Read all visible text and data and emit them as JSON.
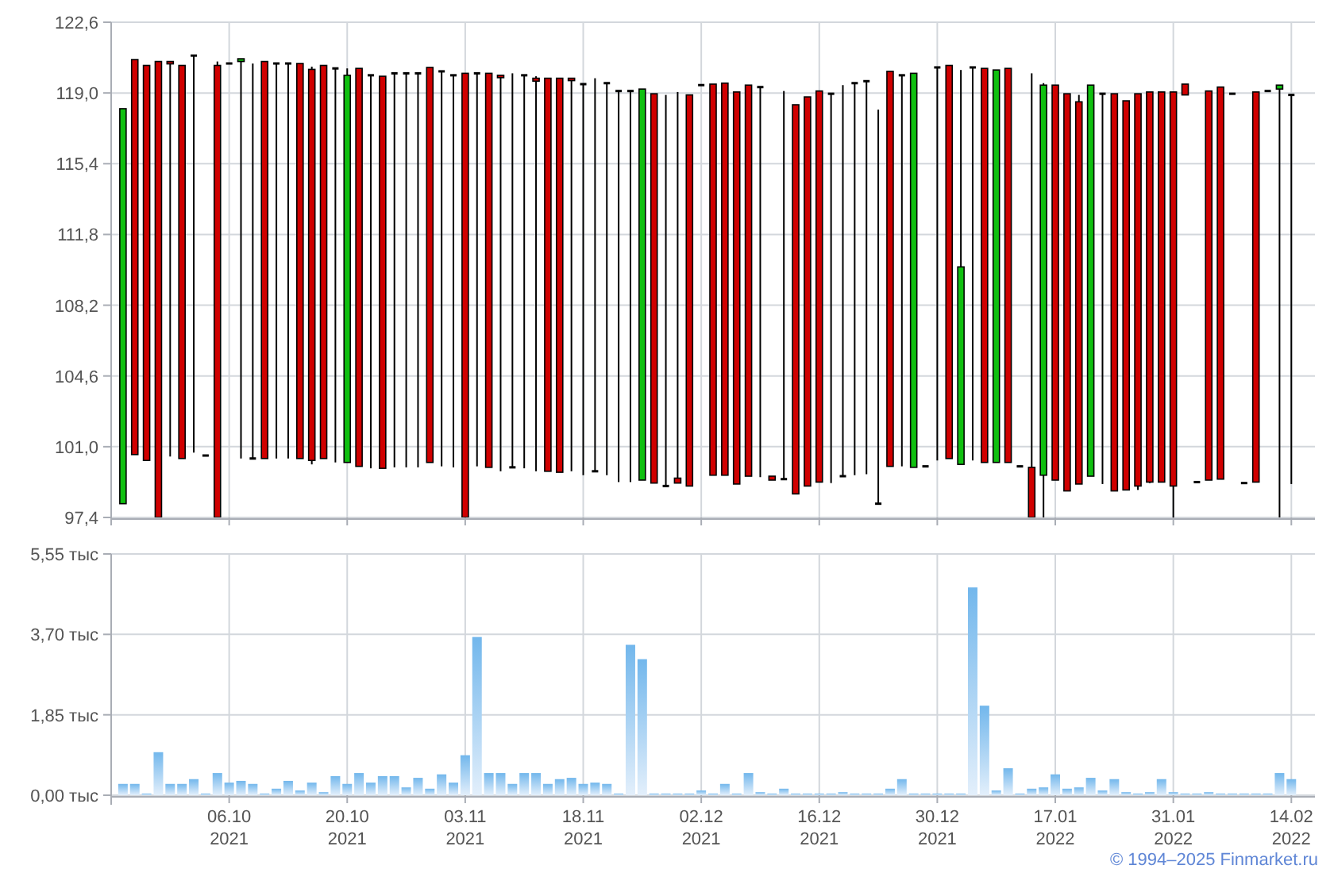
{
  "price_chart": {
    "chart_data": {
      "type": "candlestick",
      "grid": true,
      "ylim": [
        97.4,
        122.6
      ],
      "categories": [
        null,
        null,
        null,
        null,
        null,
        null,
        null,
        null,
        null,
        null,
        null,
        null,
        null,
        null,
        null,
        null,
        null,
        null,
        null,
        null,
        null,
        null,
        null,
        null,
        null,
        null,
        null,
        null,
        null,
        null,
        null,
        null,
        null,
        null,
        null,
        null,
        null,
        null,
        null,
        null,
        null,
        null,
        null,
        null,
        null,
        null,
        null,
        null,
        null,
        null,
        null,
        null,
        null,
        null,
        null,
        null,
        null,
        null,
        null,
        null,
        null,
        null,
        null,
        null,
        null,
        null,
        null,
        null,
        null,
        null,
        null,
        null,
        null,
        null,
        null,
        null,
        null,
        null,
        null,
        null,
        null,
        null,
        null,
        null,
        null,
        null,
        null,
        null,
        null,
        null,
        null,
        null,
        null,
        null,
        null,
        null,
        null,
        null,
        null,
        null
      ],
      "yticks": [
        {
          "value": 97.4,
          "label": "97,4"
        },
        {
          "value": 101.0,
          "label": "101,0"
        },
        {
          "value": 104.6,
          "label": "104,6"
        },
        {
          "value": 108.2,
          "label": "108,2"
        },
        {
          "value": 111.8,
          "label": "111,8"
        },
        {
          "value": 115.4,
          "label": "115,4"
        },
        {
          "value": 119.0,
          "label": "119,0"
        },
        {
          "value": 122.6,
          "label": "122,6"
        }
      ],
      "ohlc": [
        [
          98.1,
          118.2,
          98.1,
          118.2
        ],
        [
          120.7,
          120.7,
          100.6,
          100.6
        ],
        [
          120.4,
          120.4,
          100.3,
          100.3
        ],
        [
          120.6,
          120.6,
          97.4,
          97.4
        ],
        [
          120.6,
          120.6,
          100.5,
          120.5
        ],
        [
          120.4,
          120.4,
          100.4,
          100.4
        ],
        [
          120.9,
          120.9,
          100.7,
          120.9
        ],
        [
          100.55,
          100.55,
          100.55,
          100.55
        ],
        [
          120.4,
          120.6,
          97.4,
          97.4
        ],
        [
          120.5,
          120.5,
          120.5,
          120.5
        ],
        [
          120.6,
          120.74,
          100.4,
          120.74
        ],
        [
          100.4,
          120.5,
          100.4,
          100.4
        ],
        [
          120.6,
          120.6,
          100.4,
          100.4
        ],
        [
          120.5,
          120.5,
          100.4,
          120.5
        ],
        [
          120.5,
          120.5,
          100.4,
          120.5
        ],
        [
          120.5,
          120.5,
          100.4,
          100.4
        ],
        [
          120.2,
          120.34,
          100.1,
          100.3
        ],
        [
          120.4,
          120.4,
          100.4,
          100.4
        ],
        [
          120.25,
          120.25,
          100.2,
          120.25
        ],
        [
          100.2,
          120.25,
          100.2,
          119.9
        ],
        [
          120.25,
          120.25,
          100.0,
          100.0
        ],
        [
          119.9,
          119.9,
          99.9,
          119.9
        ],
        [
          119.85,
          119.85,
          99.9,
          99.9
        ],
        [
          120.0,
          120.0,
          99.95,
          120.0
        ],
        [
          120.0,
          120.0,
          99.95,
          120.0
        ],
        [
          120.0,
          120.0,
          99.95,
          120.0
        ],
        [
          120.3,
          120.3,
          100.2,
          100.2
        ],
        [
          120.1,
          120.1,
          100.0,
          120.1
        ],
        [
          119.9,
          119.9,
          99.95,
          119.9
        ],
        [
          120.0,
          120.0,
          97.4,
          97.4
        ],
        [
          120.0,
          120.0,
          100.0,
          120.0
        ],
        [
          120.0,
          120.0,
          99.95,
          99.95
        ],
        [
          119.9,
          119.9,
          99.75,
          119.8
        ],
        [
          99.95,
          120.0,
          99.95,
          99.95
        ],
        [
          119.9,
          119.9,
          99.9,
          119.9
        ],
        [
          119.75,
          119.85,
          99.75,
          119.6
        ],
        [
          119.75,
          119.75,
          99.75,
          99.75
        ],
        [
          119.75,
          119.75,
          99.7,
          99.7
        ],
        [
          119.75,
          119.75,
          99.75,
          119.65
        ],
        [
          119.45,
          119.45,
          99.55,
          119.45
        ],
        [
          99.75,
          119.75,
          99.75,
          99.75
        ],
        [
          119.5,
          119.5,
          99.55,
          119.5
        ],
        [
          119.1,
          119.1,
          99.2,
          119.1
        ],
        [
          119.1,
          119.1,
          99.2,
          119.1
        ],
        [
          99.3,
          119.2,
          99.3,
          119.2
        ],
        [
          118.96,
          118.96,
          99.15,
          99.15
        ],
        [
          99.0,
          118.9,
          99.0,
          99.0
        ],
        [
          99.4,
          119.05,
          99.15,
          99.15
        ],
        [
          118.9,
          118.9,
          99.0,
          99.0
        ],
        [
          119.4,
          119.4,
          119.4,
          119.4
        ],
        [
          119.45,
          119.45,
          99.55,
          99.55
        ],
        [
          119.5,
          119.5,
          99.55,
          99.55
        ],
        [
          119.05,
          119.05,
          99.1,
          99.1
        ],
        [
          119.4,
          119.4,
          99.5,
          99.5
        ],
        [
          119.3,
          119.3,
          99.45,
          119.3
        ],
        [
          99.5,
          99.5,
          99.3,
          99.3
        ],
        [
          99.35,
          119.1,
          99.35,
          99.35
        ],
        [
          118.4,
          118.4,
          98.6,
          98.6
        ],
        [
          118.8,
          118.8,
          99.0,
          99.0
        ],
        [
          119.1,
          119.1,
          99.2,
          99.2
        ],
        [
          118.96,
          118.96,
          99.15,
          118.96
        ],
        [
          99.5,
          119.4,
          99.5,
          99.5
        ],
        [
          119.5,
          119.5,
          99.55,
          119.5
        ],
        [
          119.6,
          119.6,
          99.6,
          119.6
        ],
        [
          98.1,
          118.15,
          98.1,
          98.1
        ],
        [
          120.1,
          120.1,
          100.0,
          100.0
        ],
        [
          119.9,
          119.9,
          100.0,
          119.9
        ],
        [
          99.95,
          120.0,
          99.95,
          120.0
        ],
        [
          100.0,
          100.0,
          100.0,
          100.0
        ],
        [
          120.3,
          120.3,
          100.3,
          120.3
        ],
        [
          120.4,
          120.4,
          100.4,
          100.4
        ],
        [
          100.1,
          120.17,
          100.1,
          110.15
        ],
        [
          120.3,
          120.3,
          100.3,
          120.3
        ],
        [
          120.25,
          120.25,
          100.2,
          100.2
        ],
        [
          100.2,
          120.17,
          100.2,
          120.17
        ],
        [
          120.25,
          120.25,
          100.2,
          100.2
        ],
        [
          100.0,
          100.0,
          100.0,
          100.0
        ],
        [
          99.95,
          120.0,
          97.4,
          97.4
        ],
        [
          99.55,
          119.5,
          97.4,
          119.4
        ],
        [
          119.4,
          119.4,
          99.3,
          99.3
        ],
        [
          118.96,
          118.96,
          98.75,
          98.75
        ],
        [
          118.55,
          118.9,
          99.1,
          99.1
        ],
        [
          99.5,
          119.4,
          99.5,
          119.4
        ],
        [
          118.96,
          118.96,
          99.1,
          118.96
        ],
        [
          118.96,
          118.96,
          98.75,
          98.75
        ],
        [
          118.6,
          118.6,
          98.8,
          98.8
        ],
        [
          118.96,
          118.96,
          98.8,
          99.0
        ],
        [
          119.05,
          119.05,
          99.15,
          99.2
        ],
        [
          119.05,
          119.05,
          99.2,
          99.2
        ],
        [
          119.05,
          119.05,
          97.4,
          99.0
        ],
        [
          119.45,
          119.45,
          118.9,
          118.9
        ],
        [
          99.2,
          99.2,
          99.2,
          99.2
        ],
        [
          119.1,
          119.1,
          99.3,
          99.3
        ],
        [
          119.3,
          119.3,
          99.35,
          99.35
        ],
        [
          118.96,
          118.96,
          118.96,
          118.96
        ],
        [
          99.15,
          99.15,
          99.15,
          99.15
        ],
        [
          119.05,
          119.05,
          99.2,
          99.2
        ],
        [
          119.1,
          119.1,
          119.1,
          119.1
        ],
        [
          119.2,
          119.4,
          97.4,
          119.4
        ],
        [
          118.9,
          118.9,
          99.1,
          118.9
        ]
      ]
    }
  },
  "volume_chart": {
    "chart_data": {
      "type": "bar",
      "grid": true,
      "ylim": [
        0,
        5.55
      ],
      "categories": [
        null,
        null,
        null,
        null,
        null,
        null,
        null,
        null,
        null,
        "06.10\n2021",
        null,
        null,
        null,
        null,
        null,
        null,
        null,
        null,
        null,
        "20.10\n2021",
        null,
        null,
        null,
        null,
        null,
        null,
        null,
        null,
        null,
        "03.11\n2021",
        null,
        null,
        null,
        null,
        null,
        null,
        null,
        null,
        null,
        "18.11\n2021",
        null,
        null,
        null,
        null,
        null,
        null,
        null,
        null,
        null,
        "02.12\n2021",
        null,
        null,
        null,
        null,
        null,
        null,
        null,
        null,
        null,
        "16.12\n2021",
        null,
        null,
        null,
        null,
        null,
        null,
        null,
        null,
        null,
        "30.12\n2021",
        null,
        null,
        null,
        null,
        null,
        null,
        null,
        null,
        null,
        "17.01\n2022",
        null,
        null,
        null,
        null,
        null,
        null,
        null,
        null,
        null,
        "31.01\n2022",
        null,
        null,
        null,
        null,
        null,
        null,
        null,
        null,
        null,
        "14.02\n2022"
      ],
      "yticks": [
        {
          "value": 0,
          "label": "0,00 тыс"
        },
        {
          "value": 1.85,
          "label": "1,85 тыс"
        },
        {
          "value": 3.7,
          "label": "3,70 тыс"
        },
        {
          "value": 5.55,
          "label": "5,55 тыс"
        }
      ],
      "values": [
        0.26,
        0.26,
        0.04,
        0.99,
        0.26,
        0.26,
        0.37,
        0.04,
        0.51,
        0.29,
        0.33,
        0.26,
        0.04,
        0.15,
        0.33,
        0.11,
        0.29,
        0.07,
        0.44,
        0.26,
        0.51,
        0.29,
        0.44,
        0.44,
        0.18,
        0.4,
        0.15,
        0.48,
        0.29,
        0.92,
        3.64,
        0.51,
        0.51,
        0.26,
        0.51,
        0.51,
        0.26,
        0.37,
        0.4,
        0.26,
        0.29,
        0.26,
        0.04,
        3.46,
        3.13,
        0.04,
        0.04,
        0.04,
        0.04,
        0.11,
        0.04,
        0.26,
        0.04,
        0.51,
        0.07,
        0.04,
        0.15,
        0.04,
        0.04,
        0.04,
        0.04,
        0.07,
        0.04,
        0.04,
        0.04,
        0.15,
        0.37,
        0.04,
        0.04,
        0.04,
        0.04,
        0.04,
        4.78,
        2.06,
        0.11,
        0.62,
        0.04,
        0.15,
        0.18,
        0.48,
        0.15,
        0.18,
        0.4,
        0.11,
        0.37,
        0.07,
        0.04,
        0.07,
        0.37,
        0.07,
        0.04,
        0.04,
        0.07,
        0.04,
        0.04,
        0.04,
        0.04,
        0.04,
        0.51,
        0.37
      ]
    }
  },
  "footer": {
    "copyright": "© 1994–2025 Finmarket.ru"
  }
}
